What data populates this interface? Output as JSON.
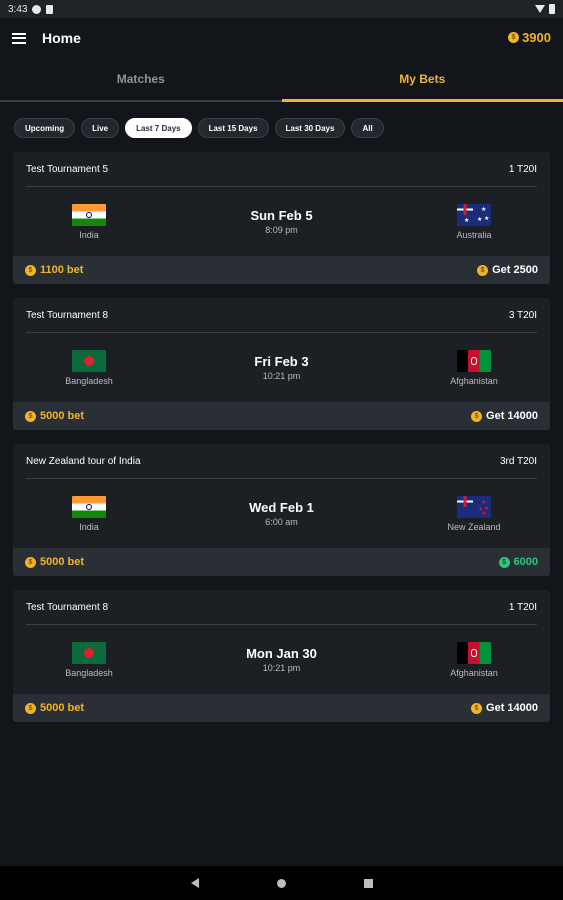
{
  "status_bar": {
    "time": "3:43"
  },
  "app_bar": {
    "title": "Home",
    "coins": "3900"
  },
  "tabs": [
    {
      "label": "Matches",
      "active": false
    },
    {
      "label": "My Bets",
      "active": true
    }
  ],
  "filters": [
    {
      "label": "Upcoming",
      "active": false
    },
    {
      "label": "Live",
      "active": false
    },
    {
      "label": "Last 7 Days",
      "active": true
    },
    {
      "label": "Last 15 Days",
      "active": false
    },
    {
      "label": "Last 30 Days",
      "active": false
    },
    {
      "label": "All",
      "active": false
    }
  ],
  "bets": [
    {
      "tournament": "Test Tournament 5",
      "format": "1 T20I",
      "team1": "India",
      "team2": "Australia",
      "date": "Sun Feb 5",
      "time": "8:09 pm",
      "bet": "1100 bet",
      "result": "Get 2500"
    },
    {
      "tournament": "Test Tournament 8",
      "format": "3 T20I",
      "team1": "Bangladesh",
      "team2": "Afghanistan",
      "date": "Fri Feb 3",
      "time": "10:21 pm",
      "bet": "5000 bet",
      "result": "Get 14000"
    },
    {
      "tournament": "New Zealand tour of India",
      "format": "3rd T20I",
      "team1": "India",
      "team2": "New Zealand",
      "date": "Wed Feb 1",
      "time": "6:00 am",
      "bet": "5000 bet",
      "result": "6000"
    },
    {
      "tournament": "Test Tournament 8",
      "format": "1 T20I",
      "team1": "Bangladesh",
      "team2": "Afghanistan",
      "date": "Mon Jan 30",
      "time": "10:21 pm",
      "bet": "5000 bet",
      "result": "Get 14000"
    }
  ],
  "colors": {
    "accent": "#f0b429",
    "won": "#2ec47a",
    "background": "#12161b",
    "card": "#1c2025"
  }
}
